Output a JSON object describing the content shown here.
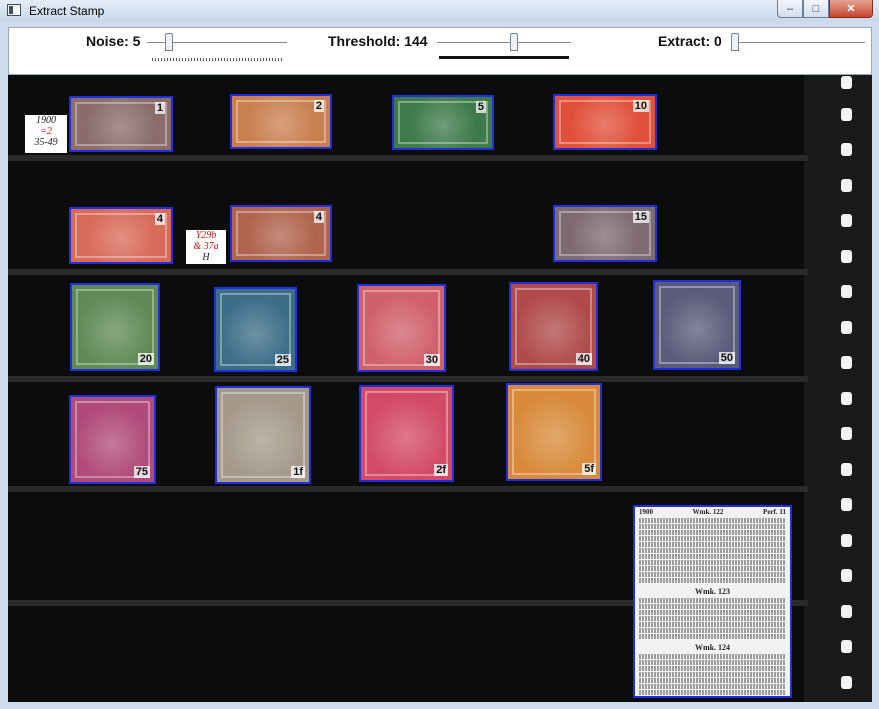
{
  "window": {
    "title": "Extract Stamp",
    "minimize": "–",
    "maximize": "□",
    "close": "✕"
  },
  "toolbar": {
    "noise_label": "Noise: 5",
    "threshold_label": "Threshold: 144",
    "extract_label": "Extract: 0",
    "noise_value": 5,
    "threshold_value": 144,
    "extract_value": 0
  },
  "notes": {
    "note1_line1": "1900",
    "note1_line2": "=2",
    "note1_line3": "35-49",
    "note2_line1": "Y29b",
    "note2_line2": "& 37a",
    "note2_line3": "H"
  },
  "stamps": [
    {
      "denom": "1",
      "color": "#8a6d6b"
    },
    {
      "denom": "2",
      "color": "#c98050"
    },
    {
      "denom": "5",
      "color": "#3e7a4a"
    },
    {
      "denom": "10",
      "color": "#e0503a"
    },
    {
      "denom": "4",
      "color": "#d86a5a"
    },
    {
      "denom": "4",
      "color": "#b0644e"
    },
    {
      "denom": "15",
      "color": "#7e6a72"
    },
    {
      "denom": "20",
      "color": "#5f8a55"
    },
    {
      "denom": "25",
      "color": "#3d6d88"
    },
    {
      "denom": "30",
      "color": "#d0606a"
    },
    {
      "denom": "40",
      "color": "#b04a4a"
    },
    {
      "denom": "50",
      "color": "#5a5a7a"
    },
    {
      "denom": "75",
      "color": "#b04a7a"
    },
    {
      "denom": "1f",
      "color": "#a59a8a"
    },
    {
      "denom": "2f",
      "color": "#d34a66"
    },
    {
      "denom": "5f",
      "color": "#d88a3a"
    }
  ],
  "catalog": {
    "year": "1900",
    "heading1": "Wmk. 122",
    "perf": "Perf. 11",
    "heading2": "Wmk. 123",
    "heading3": "Wmk. 124"
  }
}
